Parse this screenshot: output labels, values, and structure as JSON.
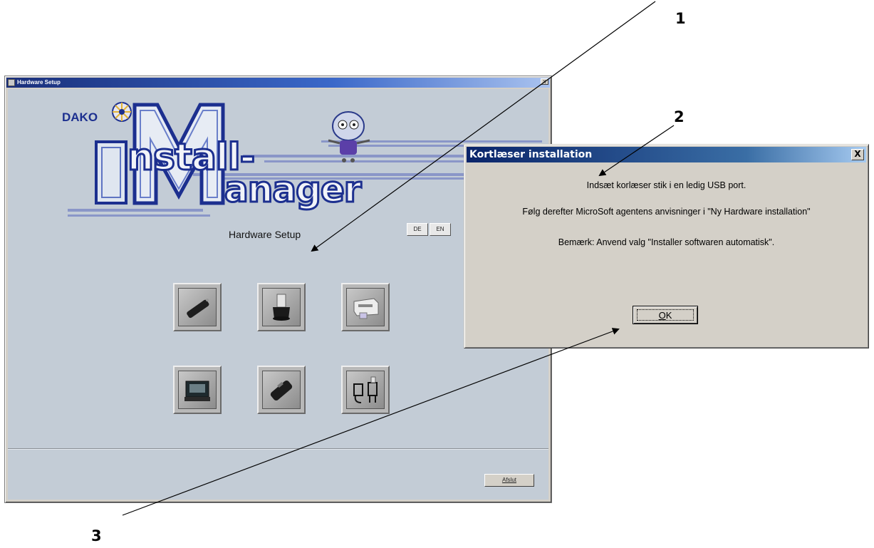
{
  "main_window": {
    "title": "Hardware Setup",
    "close_glyph": "x",
    "logo_brand": "DAKO",
    "logo_line1": "nstall-",
    "logo_line2": "anager",
    "logo_initials": "IM",
    "subtitle": "Hardware Setup",
    "languages": [
      "DE",
      "EN"
    ],
    "devices": [
      {
        "icon": "usb-stick-icon"
      },
      {
        "icon": "card-reader-stand-icon"
      },
      {
        "icon": "printer-icon"
      },
      {
        "icon": "case-device-icon"
      },
      {
        "icon": "handheld-reader-icon"
      },
      {
        "icon": "adapter-cables-icon"
      }
    ],
    "close_button_label": "Afslut"
  },
  "dialog": {
    "title": "Kortlæser installation",
    "close_glyph": "X",
    "lines": [
      "Indsæt korlæser stik i en ledig USB port.",
      "Følg derefter MicroSoft agentens anvisninger i \"Ny Hardware installation\"",
      "Bemærk: Anvend valg \"Installer softwaren automatisk\"."
    ],
    "ok_label_prefix": "O",
    "ok_label_rest": "K"
  },
  "callouts": [
    "1",
    "2",
    "3"
  ],
  "colors": {
    "title_bar": "#0a246a",
    "window_face": "#d4d0c8",
    "client_bg": "#c3ccd6",
    "logo_blue": "#1c2f8f"
  }
}
